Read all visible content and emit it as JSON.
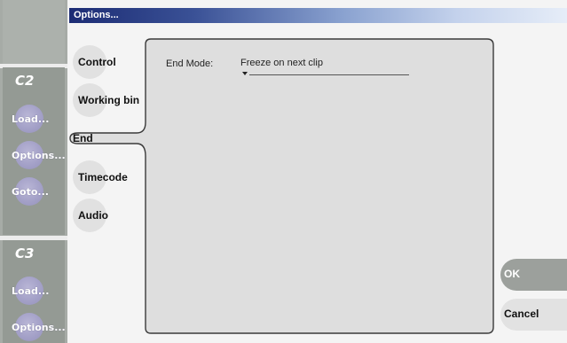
{
  "window": {
    "title": "Options..."
  },
  "sidebar": {
    "channels": [
      {
        "label": "C2",
        "buttons": [
          "Load...",
          "Options...",
          "Goto..."
        ]
      },
      {
        "label": "C3",
        "buttons": [
          "Load...",
          "Options..."
        ]
      }
    ]
  },
  "tabs": [
    {
      "label": "Control"
    },
    {
      "label": "Working bin"
    },
    {
      "label": "End",
      "selected": true
    },
    {
      "label": "Timecode"
    },
    {
      "label": "Audio"
    }
  ],
  "panel": {
    "end_mode": {
      "label": "End Mode:",
      "value": "Freeze on next clip"
    }
  },
  "buttons": {
    "ok": "OK",
    "cancel": "Cancel"
  },
  "colors": {
    "accent": "#1c2c74",
    "sidebar": "#949a94",
    "panel": "#dedede"
  }
}
